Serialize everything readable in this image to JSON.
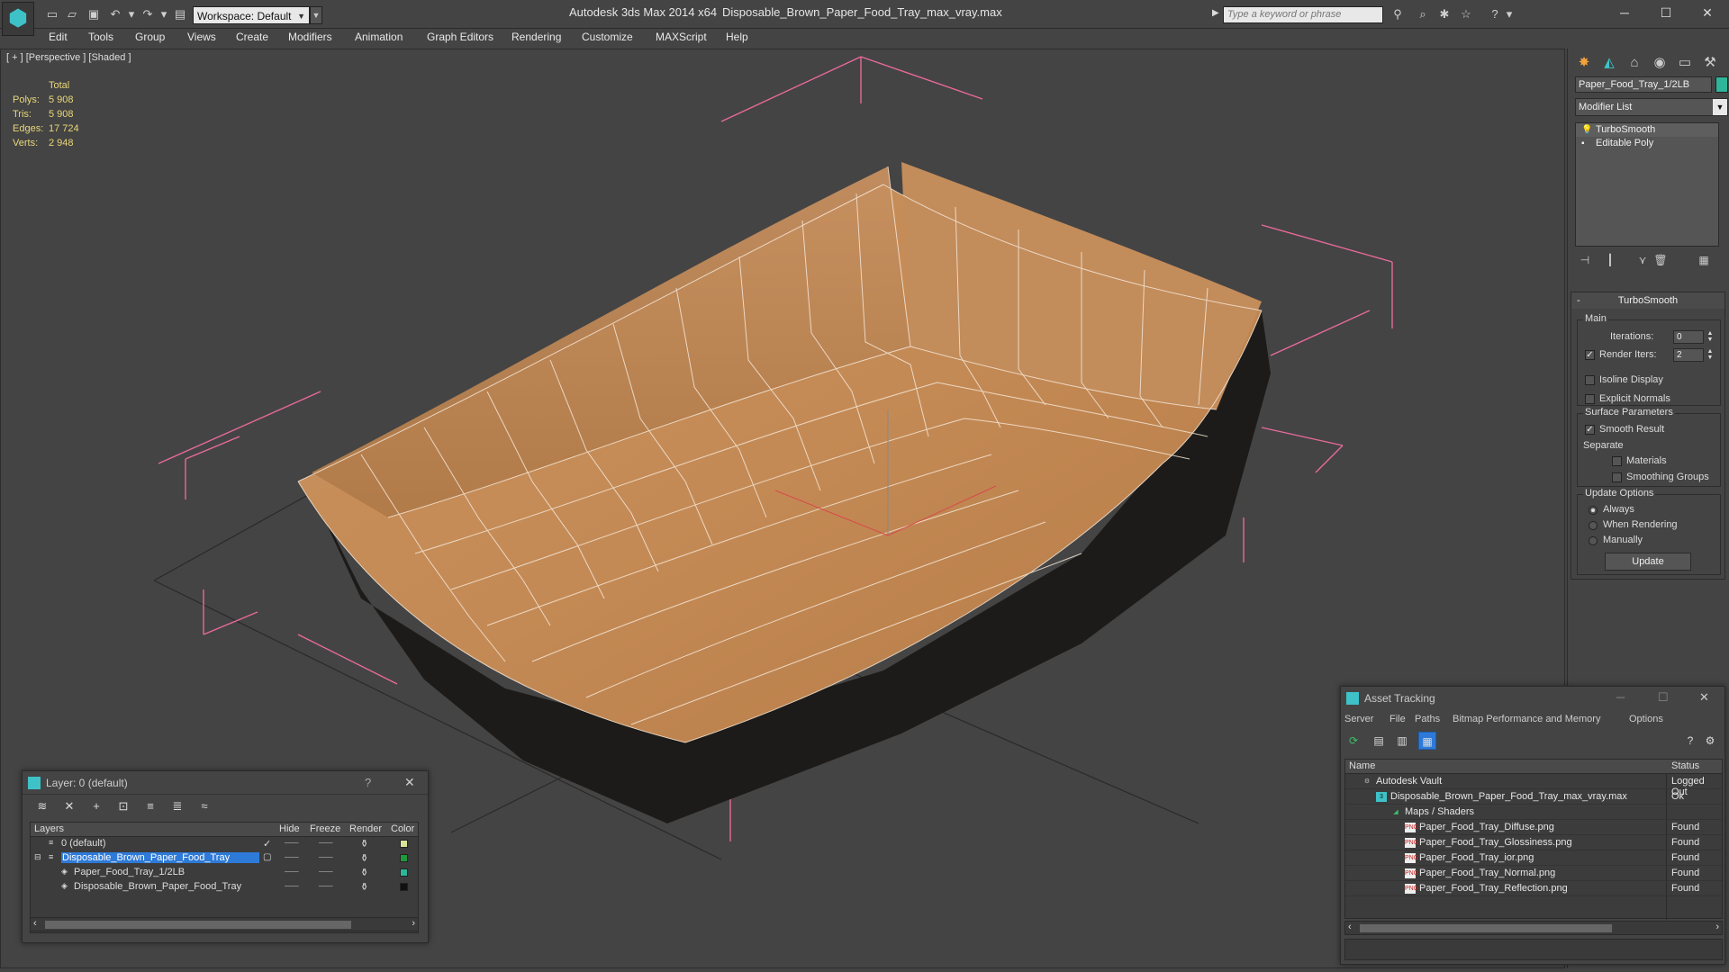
{
  "titlebar": {
    "app_title": "Autodesk 3ds Max  2014 x64",
    "file_title": "Disposable_Brown_Paper_Food_Tray_max_vray.max",
    "workspace": "Workspace: Default",
    "search_placeholder": "Type a keyword or phrase",
    "icons": [
      "new-file-icon",
      "open-icon",
      "save-icon",
      "undo-icon",
      "redo-icon",
      "project-icon"
    ]
  },
  "menu": {
    "items": [
      "Edit",
      "Tools",
      "Group",
      "Views",
      "Create",
      "Modifiers",
      "Animation",
      "Graph Editors",
      "Rendering",
      "Customize",
      "MAXScript",
      "Help"
    ]
  },
  "viewport": {
    "label": "[ + ] [Perspective ] [Shaded ]",
    "stats": {
      "header": "Total",
      "rows": [
        {
          "label": "Polys:",
          "value": "5 908"
        },
        {
          "label": "Tris:",
          "value": "5 908"
        },
        {
          "label": "Edges:",
          "value": "17 724"
        },
        {
          "label": "Verts:",
          "value": "2 948"
        }
      ]
    }
  },
  "command_panel": {
    "object_name": "Paper_Food_Tray_1/2LB",
    "object_color": "#2fb59a",
    "modifier_list": "Modifier List",
    "stack": [
      {
        "label": "TurboSmooth",
        "active": true
      },
      {
        "label": "Editable Poly",
        "active": false
      }
    ],
    "rollout": {
      "title": "TurboSmooth",
      "main_label": "Main",
      "iterations_label": "Iterations:",
      "iterations_value": "0",
      "render_iters_label": "Render Iters:",
      "render_iters_value": "2",
      "isoline_label": "Isoline Display",
      "explicit_normals_label": "Explicit Normals",
      "surface_label": "Surface Parameters",
      "smooth_result_label": "Smooth Result",
      "separate_label": "Separate",
      "materials_label": "Materials",
      "smoothing_groups_label": "Smoothing Groups",
      "update_options_label": "Update Options",
      "always_label": "Always",
      "when_rendering_label": "When Rendering",
      "manually_label": "Manually",
      "update_button": "Update"
    }
  },
  "layer_dialog": {
    "title": "Layer: 0 (default)",
    "columns": {
      "layers": "Layers",
      "hide": "Hide",
      "freeze": "Freeze",
      "render": "Render",
      "color": "Color"
    },
    "rows": [
      {
        "name": "0 (default)",
        "color": "#d8e39a",
        "selected": false,
        "indent": 1
      },
      {
        "name": "Disposable_Brown_Paper_Food_Tray",
        "color": "#1e9a3a",
        "selected": true,
        "indent": 1
      },
      {
        "name": "Paper_Food_Tray_1/2LB",
        "color": "#2fb59a",
        "selected": false,
        "indent": 2
      },
      {
        "name": "Disposable_Brown_Paper_Food_Tray",
        "color": "#111111",
        "selected": false,
        "indent": 2
      }
    ]
  },
  "asset_dialog": {
    "title": "Asset Tracking",
    "menu": [
      "Server",
      "File",
      "Paths",
      "Bitmap Performance and Memory",
      "Options"
    ],
    "columns": {
      "name": "Name",
      "status": "Status"
    },
    "rows": [
      {
        "name": "Autodesk Vault",
        "status": "Logged Out",
        "indent": 0,
        "icon": "vault-icon"
      },
      {
        "name": "Disposable_Brown_Paper_Food_Tray_max_vray.max",
        "status": "Ok",
        "indent": 1,
        "icon": "max-file-icon"
      },
      {
        "name": "Maps / Shaders",
        "status": "",
        "indent": 2,
        "icon": "maps-folder-icon"
      },
      {
        "name": "Paper_Food_Tray_Diffuse.png",
        "status": "Found",
        "indent": 3,
        "icon": "png-icon"
      },
      {
        "name": "Paper_Food_Tray_Glossiness.png",
        "status": "Found",
        "indent": 3,
        "icon": "png-icon"
      },
      {
        "name": "Paper_Food_Tray_ior.png",
        "status": "Found",
        "indent": 3,
        "icon": "png-icon"
      },
      {
        "name": "Paper_Food_Tray_Normal.png",
        "status": "Found",
        "indent": 3,
        "icon": "png-icon"
      },
      {
        "name": "Paper_Food_Tray_Reflection.png",
        "status": "Found",
        "indent": 3,
        "icon": "png-icon"
      }
    ]
  }
}
